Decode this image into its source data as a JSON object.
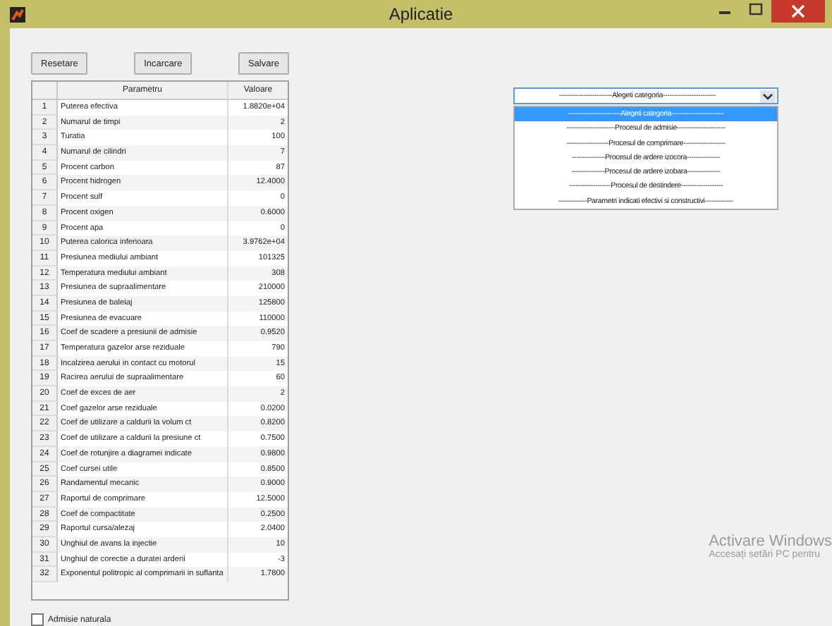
{
  "window": {
    "title": "Aplicatie"
  },
  "buttons": [
    "Resetare",
    "Incarcare",
    "Salvare"
  ],
  "table": {
    "columns": [
      "Parametru",
      "Valoare"
    ],
    "rows": [
      {
        "index": "1",
        "name": "Puterea efectiva",
        "value": "1.8820e+04"
      },
      {
        "index": "2",
        "name": "Numarul de timpi",
        "value": "2"
      },
      {
        "index": "3",
        "name": "Turatia",
        "value": "100"
      },
      {
        "index": "4",
        "name": "Numarul de cilindri",
        "value": "7"
      },
      {
        "index": "5",
        "name": "Procent carbon",
        "value": "87"
      },
      {
        "index": "6",
        "name": "Procent hidrogen",
        "value": "12.4000"
      },
      {
        "index": "7",
        "name": "Procent sulf",
        "value": "0"
      },
      {
        "index": "8",
        "name": "Procent oxigen",
        "value": "0.6000"
      },
      {
        "index": "9",
        "name": "Procent apa",
        "value": "0"
      },
      {
        "index": "10",
        "name": "Puterea calorica inferioara",
        "value": "3.9762e+04"
      },
      {
        "index": "11",
        "name": "Presiunea mediului ambiant",
        "value": "101325"
      },
      {
        "index": "12",
        "name": "Temperatura mediului ambiant",
        "value": "308"
      },
      {
        "index": "13",
        "name": "Presiunea de supraalimentare",
        "value": "210000"
      },
      {
        "index": "14",
        "name": "Presiunea de baleiaj",
        "value": "125800"
      },
      {
        "index": "15",
        "name": "Presiunea de evacuare",
        "value": "110000"
      },
      {
        "index": "16",
        "name": "Coef de scadere a presiunii de admisie",
        "value": "0.9520"
      },
      {
        "index": "17",
        "name": "Temperatura gazelor arse reziduale",
        "value": "790"
      },
      {
        "index": "18",
        "name": "Incalzirea aerului in contact cu motorul",
        "value": "15"
      },
      {
        "index": "19",
        "name": "Racirea aerului de supraalimentare",
        "value": "60"
      },
      {
        "index": "20",
        "name": "Coef de exces de aer",
        "value": "2"
      },
      {
        "index": "21",
        "name": "Coef gazelor arse reziduale",
        "value": "0.0200"
      },
      {
        "index": "22",
        "name": "Coef de utilizare a caldurii la volum ct",
        "value": "0.8200"
      },
      {
        "index": "23",
        "name": "Coef de utilizare a caldurii la presiune ct",
        "value": "0.7500"
      },
      {
        "index": "24",
        "name": "Coef de rotunjire a diagramei indicate",
        "value": "0.9800"
      },
      {
        "index": "25",
        "name": "Coef cursei utile",
        "value": "0.8500"
      },
      {
        "index": "26",
        "name": "Randamentul mecanic",
        "value": "0.9000"
      },
      {
        "index": "27",
        "name": "Raportul de comprimare",
        "value": "12.5000"
      },
      {
        "index": "28",
        "name": "Coef de compactitate",
        "value": "0.2500"
      },
      {
        "index": "29",
        "name": "Raportul cursa/alezaj",
        "value": "2.0400"
      },
      {
        "index": "30",
        "name": "Unghiul de avans la injectie",
        "value": "10"
      },
      {
        "index": "31",
        "name": "Unghiul de corectie a duratei arderii",
        "value": "-3"
      },
      {
        "index": "32",
        "name": "Exponentul politropic al comprimarii in suflanta",
        "value": "1.7800"
      }
    ]
  },
  "dropdown": {
    "value": "------------------------Alegeti categoria------------------------",
    "expanded": true,
    "options": [
      {
        "label": "------------------------Alegeti categoria------------------------",
        "selected": true
      },
      {
        "label": "----------------------Procesul de admisie----------------------",
        "selected": false
      },
      {
        "label": "-------------------Procesul de comprimare-------------------",
        "selected": false
      },
      {
        "label": "---------------Procesul de ardere izocora---------------",
        "selected": false
      },
      {
        "label": "---------------Procesul de ardere izobara---------------",
        "selected": false
      },
      {
        "label": "-------------------Procesul de destindere-------------------",
        "selected": false
      },
      {
        "label": "-------------Parametri indicati efectivi si constructivi-------------",
        "selected": false
      }
    ]
  },
  "checkbox": {
    "label": "Admisie naturala",
    "checked": false
  },
  "activation": {
    "title": "Activare Windows",
    "subtitle": "Accesați setări PC pentru"
  }
}
